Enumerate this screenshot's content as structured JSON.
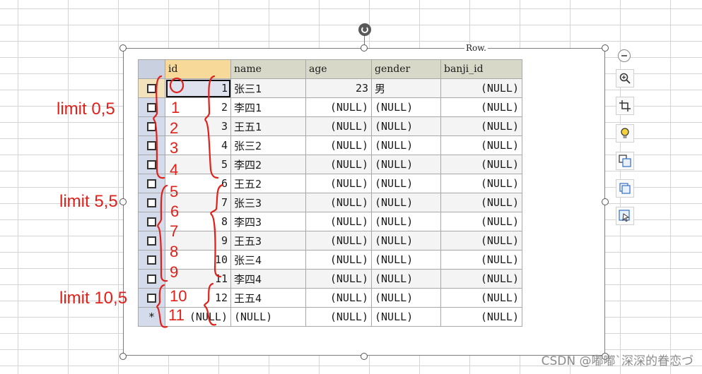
{
  "table": {
    "caption": "Row.",
    "columns": [
      "id",
      "name",
      "age",
      "gender",
      "banji_id"
    ],
    "rows": [
      {
        "id": "1",
        "name": "张三1",
        "age": "23",
        "gender": "男",
        "banji_id": "(NULL)"
      },
      {
        "id": "2",
        "name": "李四1",
        "age": "(NULL)",
        "gender": "(NULL)",
        "banji_id": "(NULL)"
      },
      {
        "id": "3",
        "name": "王五1",
        "age": "(NULL)",
        "gender": "(NULL)",
        "banji_id": "(NULL)"
      },
      {
        "id": "4",
        "name": "张三2",
        "age": "(NULL)",
        "gender": "(NULL)",
        "banji_id": "(NULL)"
      },
      {
        "id": "5",
        "name": "李四2",
        "age": "(NULL)",
        "gender": "(NULL)",
        "banji_id": "(NULL)"
      },
      {
        "id": "6",
        "name": "王五2",
        "age": "(NULL)",
        "gender": "(NULL)",
        "banji_id": "(NULL)"
      },
      {
        "id": "7",
        "name": "张三3",
        "age": "(NULL)",
        "gender": "(NULL)",
        "banji_id": "(NULL)"
      },
      {
        "id": "8",
        "name": "李四3",
        "age": "(NULL)",
        "gender": "(NULL)",
        "banji_id": "(NULL)"
      },
      {
        "id": "9",
        "name": "王五3",
        "age": "(NULL)",
        "gender": "(NULL)",
        "banji_id": "(NULL)"
      },
      {
        "id": "10",
        "name": "张三4",
        "age": "(NULL)",
        "gender": "(NULL)",
        "banji_id": "(NULL)"
      },
      {
        "id": "11",
        "name": "李四4",
        "age": "(NULL)",
        "gender": "(NULL)",
        "banji_id": "(NULL)"
      },
      {
        "id": "12",
        "name": "王五4",
        "age": "(NULL)",
        "gender": "(NULL)",
        "banji_id": "(NULL)"
      }
    ],
    "new_row": {
      "marker": "*",
      "id": "(NULL)",
      "name": "(NULL)",
      "age": "(NULL)",
      "gender": "(NULL)",
      "banji_id": "(NULL)"
    }
  },
  "annotations": {
    "groups": [
      "limit 0,5",
      "limit 5,5",
      "limit 10,5"
    ],
    "row_numbers": [
      "0",
      "1",
      "2",
      "3",
      "4",
      "5",
      "6",
      "7",
      "8",
      "9",
      "10",
      "11"
    ],
    "color": "#e0201a"
  },
  "side_toolbar": {
    "buttons": [
      "zoom-icon",
      "crop-icon",
      "bulb-icon",
      "convert-icon",
      "copy-image-icon",
      "select-image-icon"
    ]
  },
  "watermark": "CSDN @嘟嘟`深深的眷恋づ"
}
